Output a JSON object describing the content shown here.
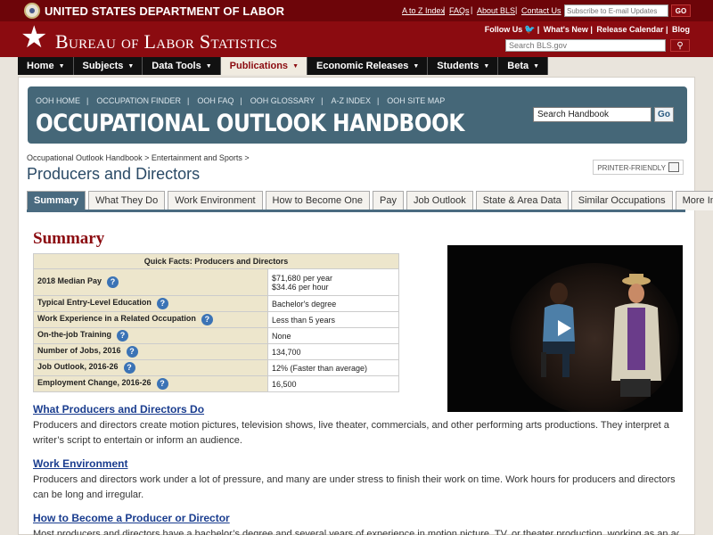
{
  "dol": {
    "title": "UNITED STATES DEPARTMENT OF LABOR",
    "links": [
      "A to Z Index",
      "FAQs",
      "About BLS",
      "Contact Us"
    ],
    "email_placeholder": "Subscribe to E-mail Updates",
    "go_label": "GO"
  },
  "bls": {
    "title": "Bureau of Labor Statistics",
    "social": [
      "Follow Us",
      "What's New",
      "Release Calendar",
      "Blog"
    ],
    "search_placeholder": "Search BLS.gov"
  },
  "nav": [
    "Home",
    "Subjects",
    "Data Tools",
    "Publications",
    "Economic Releases",
    "Students",
    "Beta"
  ],
  "ooh": {
    "links": [
      "OOH HOME",
      "OCCUPATION FINDER",
      "OOH FAQ",
      "OOH GLOSSARY",
      "A-Z INDEX",
      "OOH SITE MAP"
    ],
    "title": "OCCUPATIONAL OUTLOOK HANDBOOK",
    "search_value": "Search Handbook",
    "go_label": "Go"
  },
  "breadcrumb": [
    "Occupational Outlook Handbook",
    "Entertainment and Sports"
  ],
  "page_title": "Producers and Directors",
  "printer_label": "PRINTER-FRIENDLY",
  "tabs": [
    "Summary",
    "What They Do",
    "Work Environment",
    "How to Become One",
    "Pay",
    "Job Outlook",
    "State & Area Data",
    "Similar Occupations",
    "More Info"
  ],
  "summary_heading": "Summary",
  "quickfacts": {
    "caption": "Quick Facts: Producers and Directors",
    "rows": [
      {
        "label": "2018 Median Pay",
        "value": "$71,680 per year",
        "value2": "$34.46 per hour"
      },
      {
        "label": "Typical Entry-Level Education",
        "value": "Bachelor's degree"
      },
      {
        "label": "Work Experience in a Related Occupation",
        "value": "Less than 5 years"
      },
      {
        "label": "On-the-job Training",
        "value": "None"
      },
      {
        "label": "Number of Jobs, 2016",
        "value": "134,700"
      },
      {
        "label": "Job Outlook, 2016-26",
        "value": "12% (Faster than average)"
      },
      {
        "label": "Employment Change, 2016-26",
        "value": "16,500"
      }
    ]
  },
  "sections": [
    {
      "heading": "What Producers and Directors Do",
      "text": "Producers and directors create motion pictures, television shows, live theater, commercials, and other performing arts productions. They interpret a writer’s script to entertain or inform an audience."
    },
    {
      "heading": "Work Environment",
      "text": "Producers and directors work under a lot of pressure, and many are under stress to finish their work on time.  Work hours for producers and directors can be long and irregular."
    },
    {
      "heading": "How to Become a Producer or Director",
      "text": "Most producers and directors have a bachelor’s degree and several years of experience in motion picture, TV, or theater production, working as an actor, a film"
    }
  ],
  "colors": {
    "brand_red": "#8b0b10",
    "ooh_blue": "#456778",
    "link_blue": "#1a3d8f"
  }
}
